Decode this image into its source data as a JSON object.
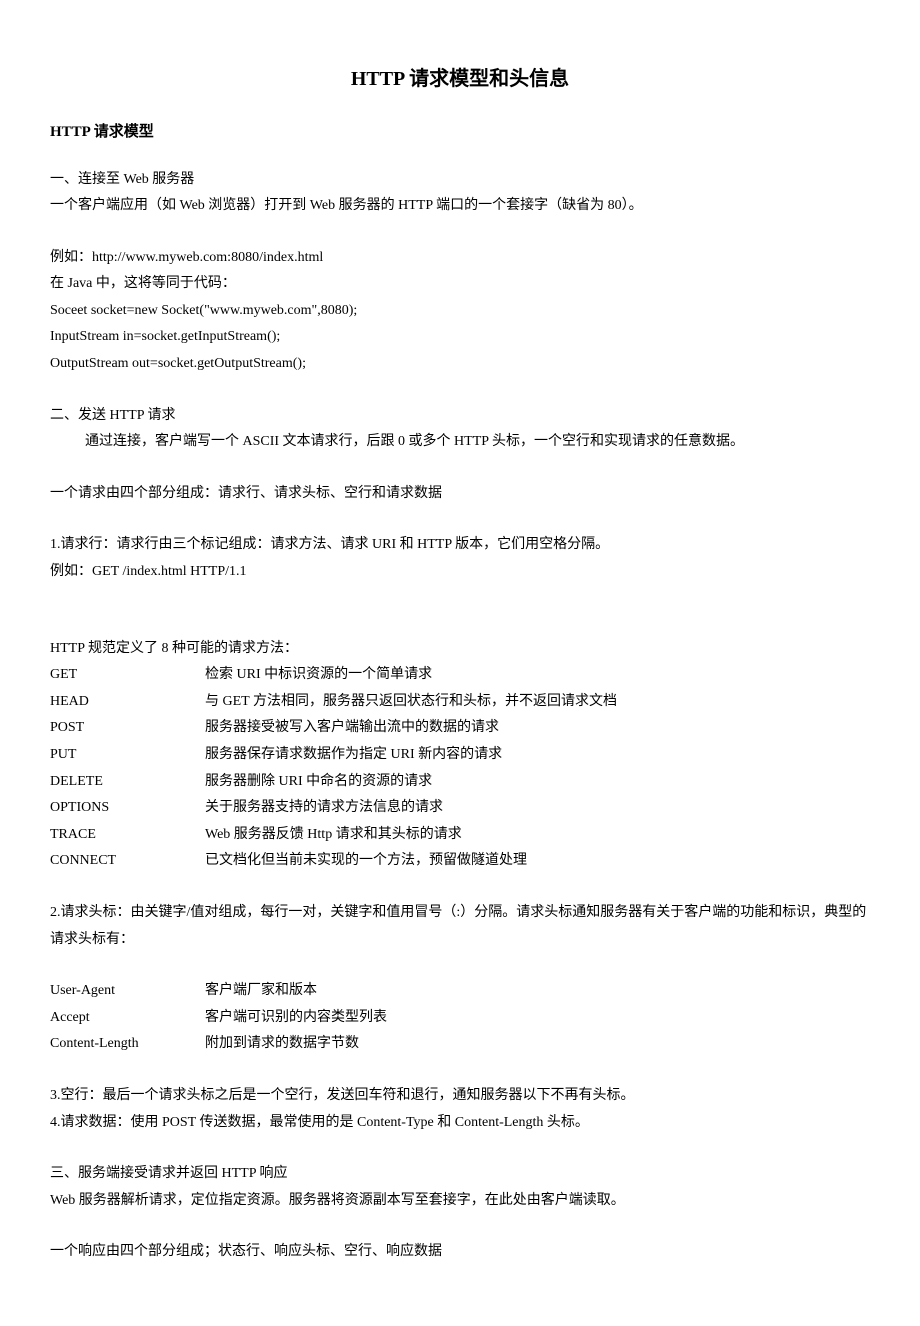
{
  "title": "HTTP 请求模型和头信息",
  "h2": "HTTP 请求模型",
  "s1": {
    "h": "一、连接至 Web 服务器",
    "p1": "一个客户端应用（如 Web 浏览器）打开到 Web 服务器的 HTTP 端口的一个套接字（缺省为 80）。",
    "p2": "例如：http://www.myweb.com:8080/index.html",
    "p3": "在 Java 中，这将等同于代码：",
    "p4": "Soceet socket=new Socket(\"www.myweb.com\",8080);",
    "p5": "InputStream in=socket.getInputStream();",
    "p6": "OutputStream out=socket.getOutputStream();"
  },
  "s2": {
    "h": "二、发送 HTTP 请求",
    "p1": "通过连接，客户端写一个 ASCII 文本请求行，后跟 0 或多个 HTTP 头标，一个空行和实现请求的任意数据。",
    "p2": "一个请求由四个部分组成：请求行、请求头标、空行和请求数据",
    "p3": "1.请求行：请求行由三个标记组成：请求方法、请求 URI 和 HTTP 版本，它们用空格分隔。",
    "p4": "例如：GET /index.html HTTP/1.1",
    "p5": "HTTP 规范定义了 8 种可能的请求方法：",
    "methods": [
      {
        "m": "GET",
        "d": "检索 URI 中标识资源的一个简单请求"
      },
      {
        "m": "HEAD",
        "d": "与 GET 方法相同，服务器只返回状态行和头标，并不返回请求文档"
      },
      {
        "m": "POST",
        "d": "服务器接受被写入客户端输出流中的数据的请求"
      },
      {
        "m": "PUT",
        "d": "服务器保存请求数据作为指定 URI 新内容的请求"
      },
      {
        "m": "DELETE",
        "d": "服务器删除 URI 中命名的资源的请求"
      },
      {
        "m": "OPTIONS",
        "d": "关于服务器支持的请求方法信息的请求"
      },
      {
        "m": "TRACE",
        "d": "Web 服务器反馈 Http 请求和其头标的请求"
      },
      {
        "m": "CONNECT",
        "d": "已文档化但当前未实现的一个方法，预留做隧道处理"
      }
    ],
    "p6": "2.请求头标：由关键字/值对组成，每行一对，关键字和值用冒号（:）分隔。请求头标通知服务器有关于客户端的功能和标识，典型的请求头标有：",
    "headers": [
      {
        "k": "User-Agent",
        "d": "客户端厂家和版本"
      },
      {
        "k": "Accept",
        "d": "客户端可识别的内容类型列表"
      },
      {
        "k": "Content-Length",
        "d": "附加到请求的数据字节数"
      }
    ],
    "p7": "3.空行：最后一个请求头标之后是一个空行，发送回车符和退行，通知服务器以下不再有头标。",
    "p8": "4.请求数据：使用 POST 传送数据，最常使用的是 Content-Type 和 Content-Length 头标。"
  },
  "s3": {
    "h": "三、服务端接受请求并返回 HTTP 响应",
    "p1": "Web 服务器解析请求，定位指定资源。服务器将资源副本写至套接字，在此处由客户端读取。",
    "p2": "一个响应由四个部分组成；状态行、响应头标、空行、响应数据"
  }
}
